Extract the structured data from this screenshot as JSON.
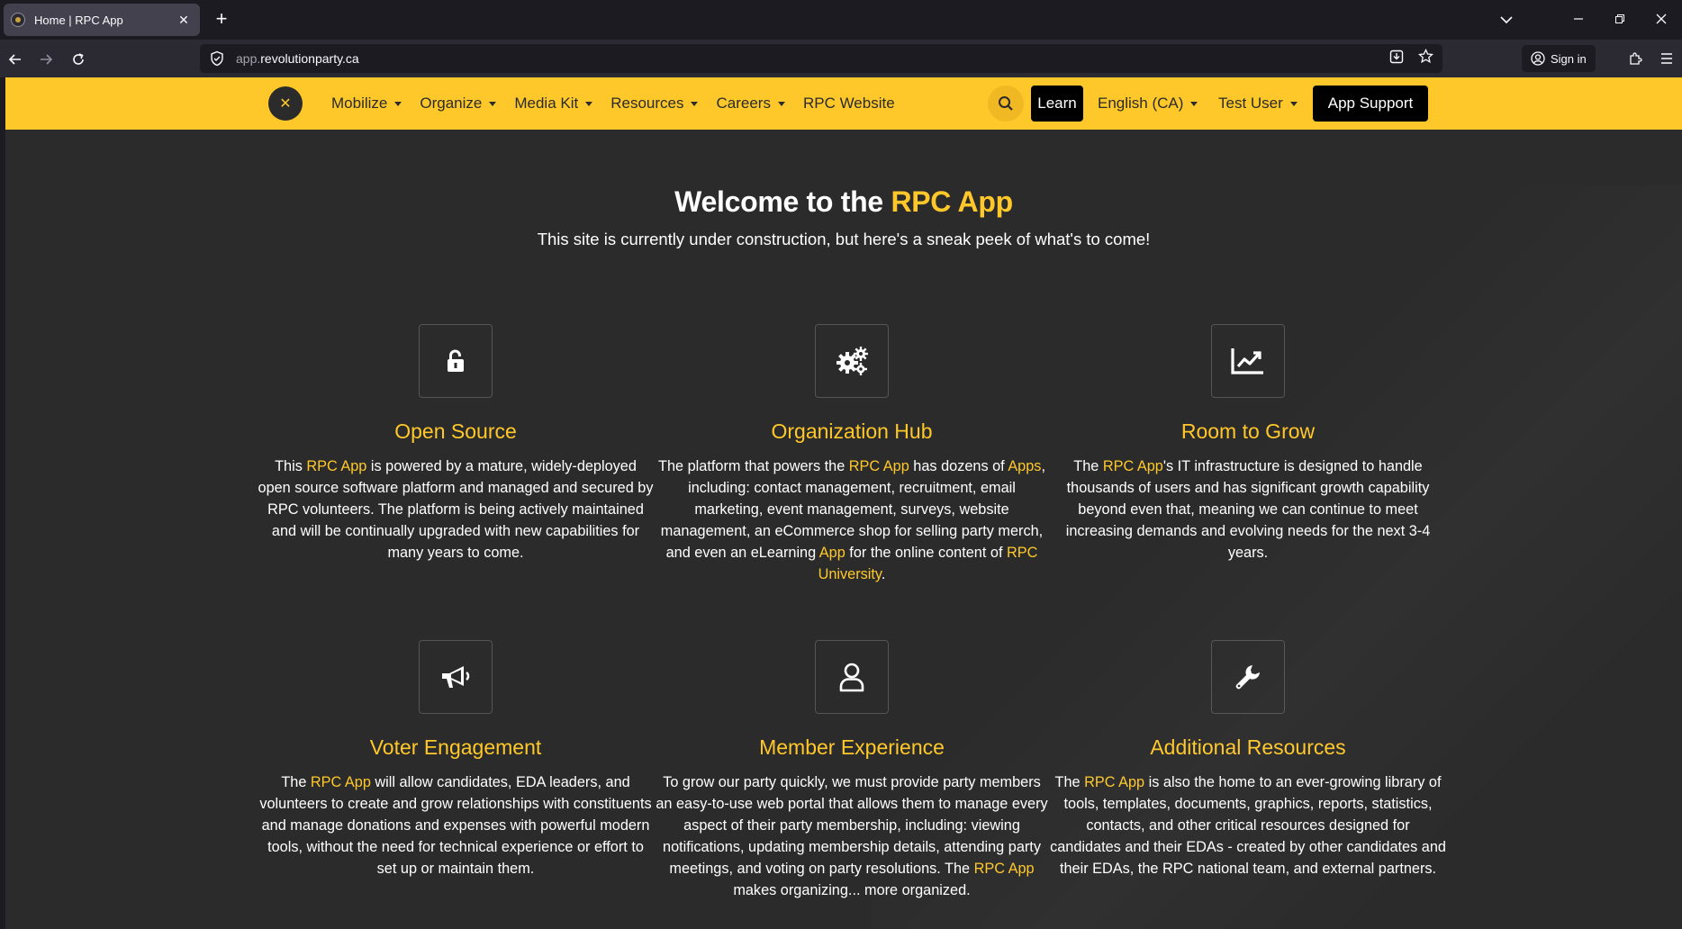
{
  "browser": {
    "tab_title": "Home | RPC App",
    "tab_close": "✕",
    "new_tab": "+",
    "url_prefix": "app.",
    "url_domain": "revolutionparty.ca",
    "sign_in": "Sign in"
  },
  "site": {
    "close_symbol": "✕",
    "menu": [
      {
        "label": "Mobilize"
      },
      {
        "label": "Organize"
      },
      {
        "label": "Media Kit"
      },
      {
        "label": "Resources"
      },
      {
        "label": "Careers"
      },
      {
        "label": "RPC Website"
      }
    ],
    "learn": "Learn",
    "language": "English (CA)",
    "user": "Test User",
    "app_support": "App Support",
    "hero": {
      "title_plain": "Welcome to the ",
      "title_accent": "RPC App",
      "subtitle": "This site is currently under construction, but here's a sneak peek of what's to come!"
    },
    "cards": [
      {
        "title": "Open Source",
        "icon": "unlock-icon",
        "text": [
          {
            "t": "This "
          },
          {
            "t": "RPC App",
            "hl": true
          },
          {
            "t": " is powered by a mature, widely-deployed open source software platform and managed and secured by RPC volunteers. The platform is being actively maintained and will be continually upgraded with new capabilities for many years to come."
          }
        ]
      },
      {
        "title": "Organization Hub",
        "icon": "gears-icon",
        "text": [
          {
            "t": "The platform that powers the "
          },
          {
            "t": "RPC App",
            "hl": true
          },
          {
            "t": " has dozens of "
          },
          {
            "t": "Apps",
            "hl": true
          },
          {
            "t": ", including: contact management, recruitment, email marketing, event management, surveys, website management, an eCommerce shop for selling party merch, and even an eLearning "
          },
          {
            "t": "App",
            "hl": true
          },
          {
            "t": " for the online content of "
          },
          {
            "t": "RPC University",
            "hl": true
          },
          {
            "t": "."
          }
        ]
      },
      {
        "title": "Room to Grow",
        "icon": "chart-line-icon",
        "text": [
          {
            "t": "The "
          },
          {
            "t": "RPC App",
            "hl": true
          },
          {
            "t": "'s IT infrastructure is designed to handle thousands of users and has significant growth capability beyond even that, meaning we can continue to meet increasing demands and evolving needs for the next 3-4 years."
          }
        ]
      },
      {
        "title": "Voter Engagement",
        "icon": "megaphone-icon",
        "text": [
          {
            "t": "The "
          },
          {
            "t": "RPC App",
            "hl": true
          },
          {
            "t": " will allow candidates, EDA leaders, and volunteers to create and grow relationships with constituents and manage donations and expenses with powerful modern tools, without the need for technical experience or effort to set up or maintain them."
          }
        ]
      },
      {
        "title": "Member Experience",
        "icon": "user-icon",
        "text": [
          {
            "t": "To grow our party quickly, we must provide party members an easy-to-use web portal that allows them to manage every aspect of their party membership, including: viewing notifications, updating membership details, attending party meetings, and voting on party resolutions. The "
          },
          {
            "t": "RPC App",
            "hl": true
          },
          {
            "t": " makes organizing... more organized."
          }
        ]
      },
      {
        "title": "Additional Resources",
        "icon": "wrench-icon",
        "text": [
          {
            "t": "The "
          },
          {
            "t": "RPC App",
            "hl": true
          },
          {
            "t": " is also the home to an ever-growing library of tools, templates, documents, graphics, reports, statistics, contacts, and other critical resources designed for candidates and their EDAs - created by other candidates and their EDAs, the RPC national team, and external partners."
          }
        ]
      }
    ]
  }
}
